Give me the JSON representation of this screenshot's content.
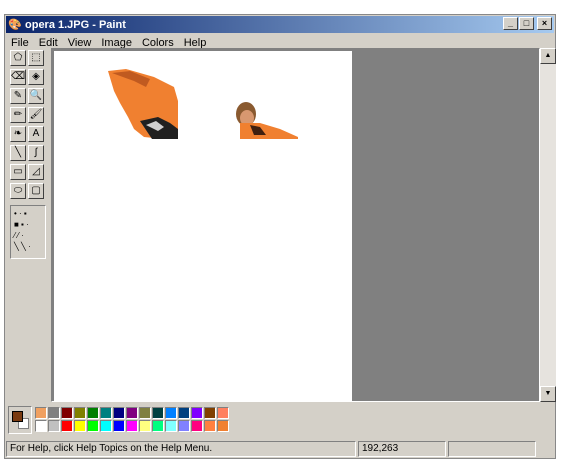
{
  "window": {
    "title": "opera 1.JPG - Paint",
    "buttons": {
      "minimize": "_",
      "maximize": "□",
      "close": "×"
    }
  },
  "menu": [
    "File",
    "Edit",
    "View",
    "Image",
    "Colors",
    "Help"
  ],
  "tools": [
    {
      "name": "free-form-select",
      "glyph": "⬠"
    },
    {
      "name": "select",
      "glyph": "⬚"
    },
    {
      "name": "eraser",
      "glyph": "⌫"
    },
    {
      "name": "fill",
      "glyph": "◈"
    },
    {
      "name": "pick-color",
      "glyph": "✎"
    },
    {
      "name": "magnifier",
      "glyph": "🔍"
    },
    {
      "name": "pencil",
      "glyph": "✏"
    },
    {
      "name": "brush",
      "glyph": "🖌"
    },
    {
      "name": "airbrush",
      "glyph": "❧"
    },
    {
      "name": "text",
      "glyph": "A"
    },
    {
      "name": "line",
      "glyph": "╲"
    },
    {
      "name": "curve",
      "glyph": "∫"
    },
    {
      "name": "rectangle",
      "glyph": "▭"
    },
    {
      "name": "polygon",
      "glyph": "◿"
    },
    {
      "name": "ellipse",
      "glyph": "⬭"
    },
    {
      "name": "rounded-rectangle",
      "glyph": "▢"
    }
  ],
  "tool_options_rows": [
    "• · ▪",
    "■ ▪ ·",
    "⁄ ⁄ ·",
    "╲ ╲ ·"
  ],
  "palette": {
    "foreground": "#7a3a10",
    "background": "#ffffff",
    "top_row": [
      "#f0a060",
      "#808080",
      "#800000",
      "#808000",
      "#008000",
      "#008080",
      "#000080",
      "#800080",
      "#808040",
      "#004040",
      "#0080ff",
      "#004080",
      "#8000ff",
      "#804000",
      "#ff8060"
    ],
    "bottom_row": [
      "#ffffff",
      "#c0c0c0",
      "#ff0000",
      "#ffff00",
      "#00ff00",
      "#00ffff",
      "#0000ff",
      "#ff00ff",
      "#ffff80",
      "#00ff80",
      "#80ffff",
      "#8080ff",
      "#ff0080",
      "#ff8040",
      "#f08030"
    ]
  },
  "status": {
    "help_text": "For Help, click Help Topics on the Help Menu.",
    "coords": "192,263",
    "size": ""
  }
}
